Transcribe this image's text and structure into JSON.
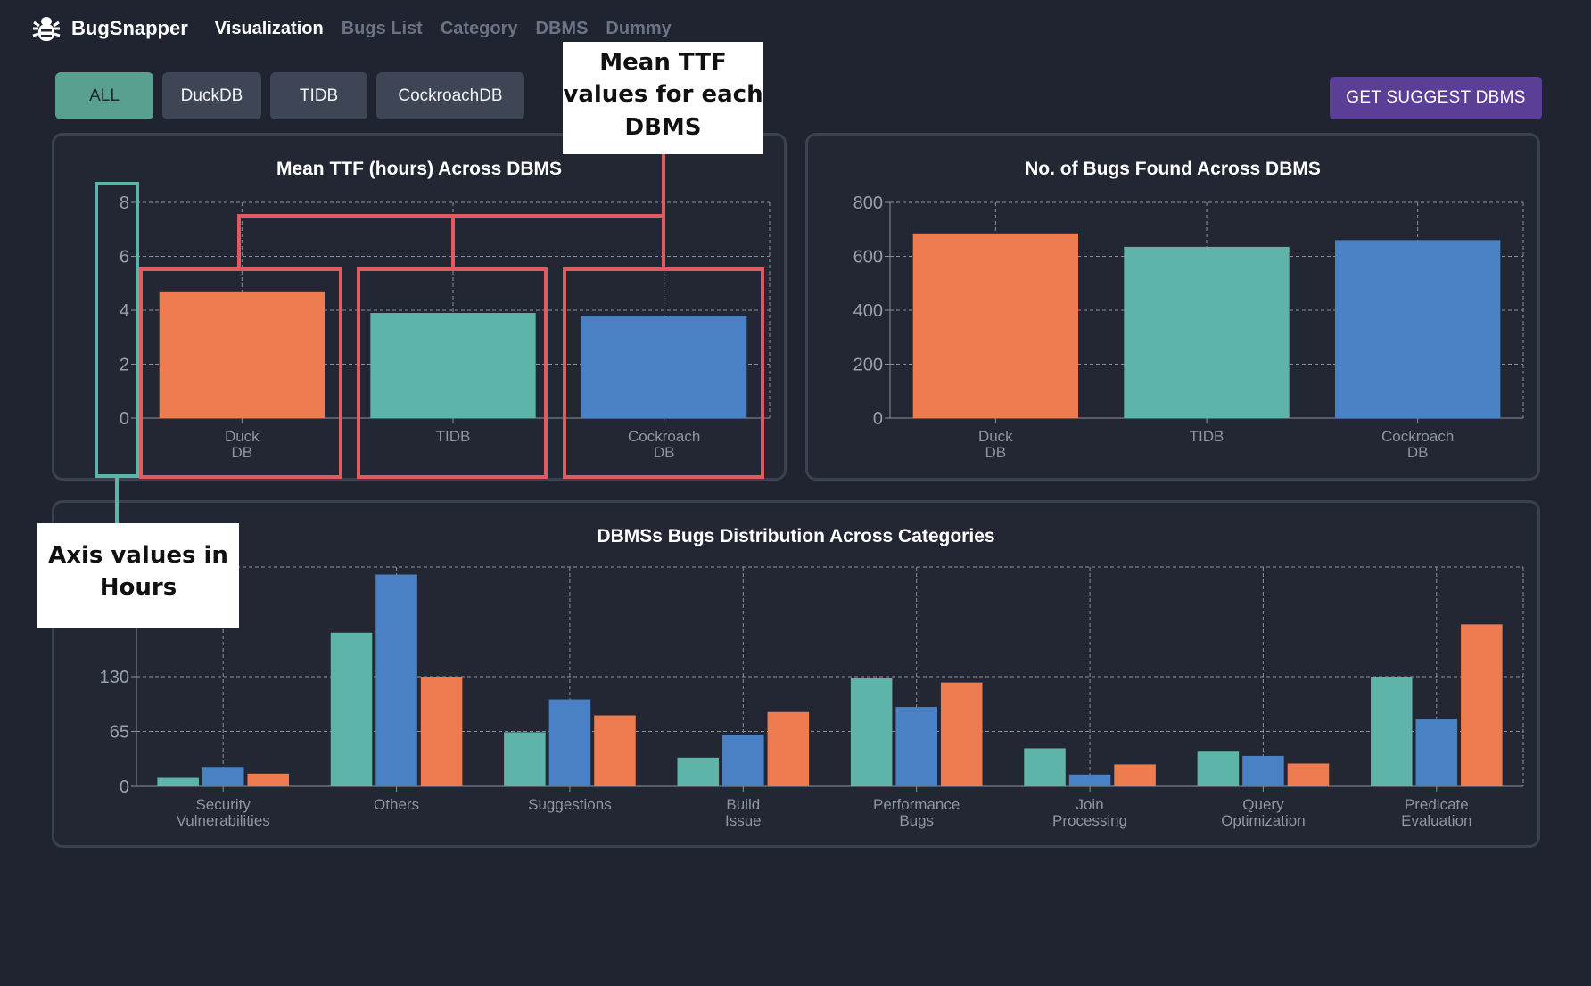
{
  "app": {
    "name": "BugSnapper"
  },
  "nav": {
    "items": [
      {
        "label": "Visualization",
        "active": true
      },
      {
        "label": "Bugs List",
        "active": false
      },
      {
        "label": "Category",
        "active": false
      },
      {
        "label": "DBMS",
        "active": false
      },
      {
        "label": "Dummy",
        "active": false
      }
    ]
  },
  "filters": {
    "buttons": [
      {
        "label": "ALL",
        "active": true
      },
      {
        "label": "DuckDB",
        "active": false
      },
      {
        "label": "TIDB",
        "active": false
      },
      {
        "label": "CockroachDB",
        "active": false
      }
    ]
  },
  "actions": {
    "suggest_label": "GET SUGGEST DBMS"
  },
  "colors": {
    "duckdb": "#ef7b51",
    "tidb": "#5eb4a8",
    "cockroachdb": "#4a80c4",
    "accent": "#5b3e96",
    "highlight_red": "#e05a5f",
    "highlight_teal": "#5eb4a8"
  },
  "annotations": {
    "ttf_note": [
      "Mean TTF",
      "values for each",
      "DBMS"
    ],
    "axis_note": [
      "Axis values in",
      "Hours"
    ]
  },
  "chart_data": [
    {
      "type": "bar",
      "title": "Mean TTF (hours) Across DBMS",
      "categories": [
        [
          "Duck",
          "DB"
        ],
        [
          "TIDB"
        ],
        [
          "Cockroach",
          "DB"
        ]
      ],
      "values": [
        4.7,
        3.9,
        3.8
      ],
      "bar_colors": [
        "#ef7b51",
        "#5eb4a8",
        "#4a80c4"
      ],
      "yticks": [
        0,
        2,
        4,
        6,
        8
      ],
      "ylim": [
        0,
        8
      ],
      "grid": true
    },
    {
      "type": "bar",
      "title": "No. of Bugs Found Across DBMS",
      "categories": [
        [
          "Duck",
          "DB"
        ],
        [
          "TIDB"
        ],
        [
          "Cockroach",
          "DB"
        ]
      ],
      "values": [
        685,
        635,
        660
      ],
      "bar_colors": [
        "#ef7b51",
        "#5eb4a8",
        "#4a80c4"
      ],
      "yticks": [
        0,
        200,
        400,
        600,
        800
      ],
      "ylim": [
        0,
        800
      ],
      "grid": true
    },
    {
      "type": "bar",
      "title": "DBMSs Bugs Distribution Across Categories",
      "categories": [
        [
          "Security",
          "Vulnerabilities"
        ],
        [
          "Others"
        ],
        [
          "Suggestions"
        ],
        [
          "Build",
          "Issue"
        ],
        [
          "Performance",
          "Bugs"
        ],
        [
          "Join",
          "Processing"
        ],
        [
          "Query",
          "Optimization"
        ],
        [
          "Predicate",
          "Evaluation"
        ]
      ],
      "series": [
        {
          "color": "#5eb4a8",
          "values": [
            10,
            182,
            64,
            34,
            128,
            45,
            42,
            130
          ]
        },
        {
          "color": "#4a80c4",
          "values": [
            23,
            251,
            103,
            61,
            94,
            14,
            36,
            80
          ]
        },
        {
          "color": "#ef7b51",
          "values": [
            15,
            130,
            84,
            88,
            123,
            26,
            27,
            192
          ]
        }
      ],
      "yticks": [
        0,
        65,
        130
      ],
      "ylim": [
        0,
        260
      ],
      "grid": true
    }
  ]
}
